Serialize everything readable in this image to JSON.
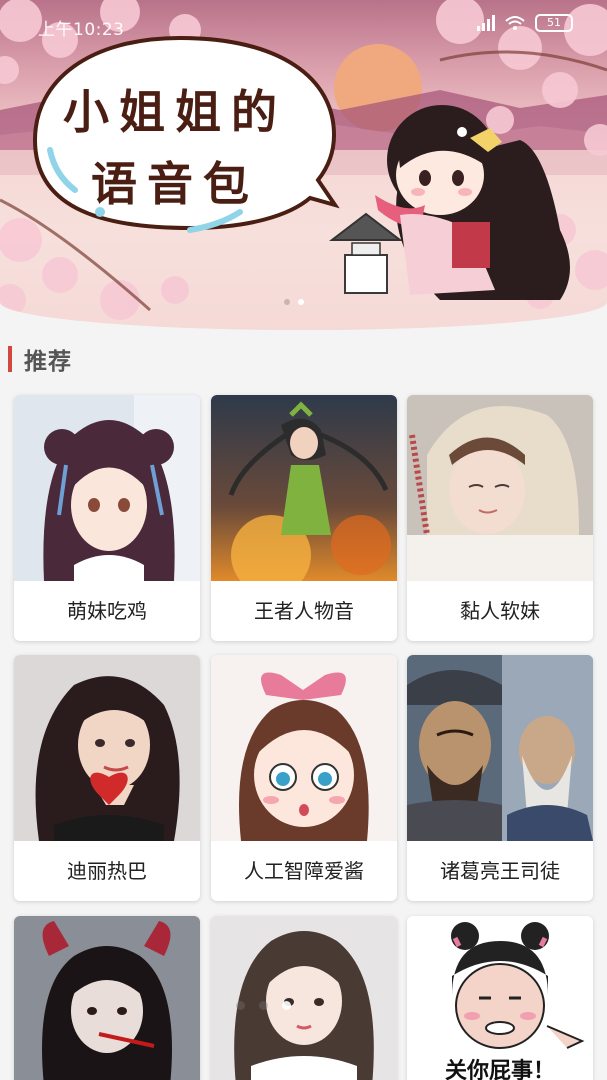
{
  "status_bar": {
    "time": "上午10:23",
    "battery": "51"
  },
  "banner": {
    "line1": "小姐姐的",
    "line2": "语音包",
    "pages": 2,
    "active_page": 1
  },
  "section": {
    "title": "推荐"
  },
  "voice_packs": [
    {
      "label": "萌妹吃鸡"
    },
    {
      "label": "王者人物音"
    },
    {
      "label": "黏人软妹"
    },
    {
      "label": "迪丽热巴"
    },
    {
      "label": "人工智障爱酱"
    },
    {
      "label": "诸葛亮王司徒"
    },
    {
      "label": ""
    },
    {
      "label": ""
    },
    {
      "label": "",
      "caption": "关你屁事！"
    }
  ],
  "colors": {
    "accent": "#d2483f",
    "bubble_text": "#4a1e12"
  }
}
